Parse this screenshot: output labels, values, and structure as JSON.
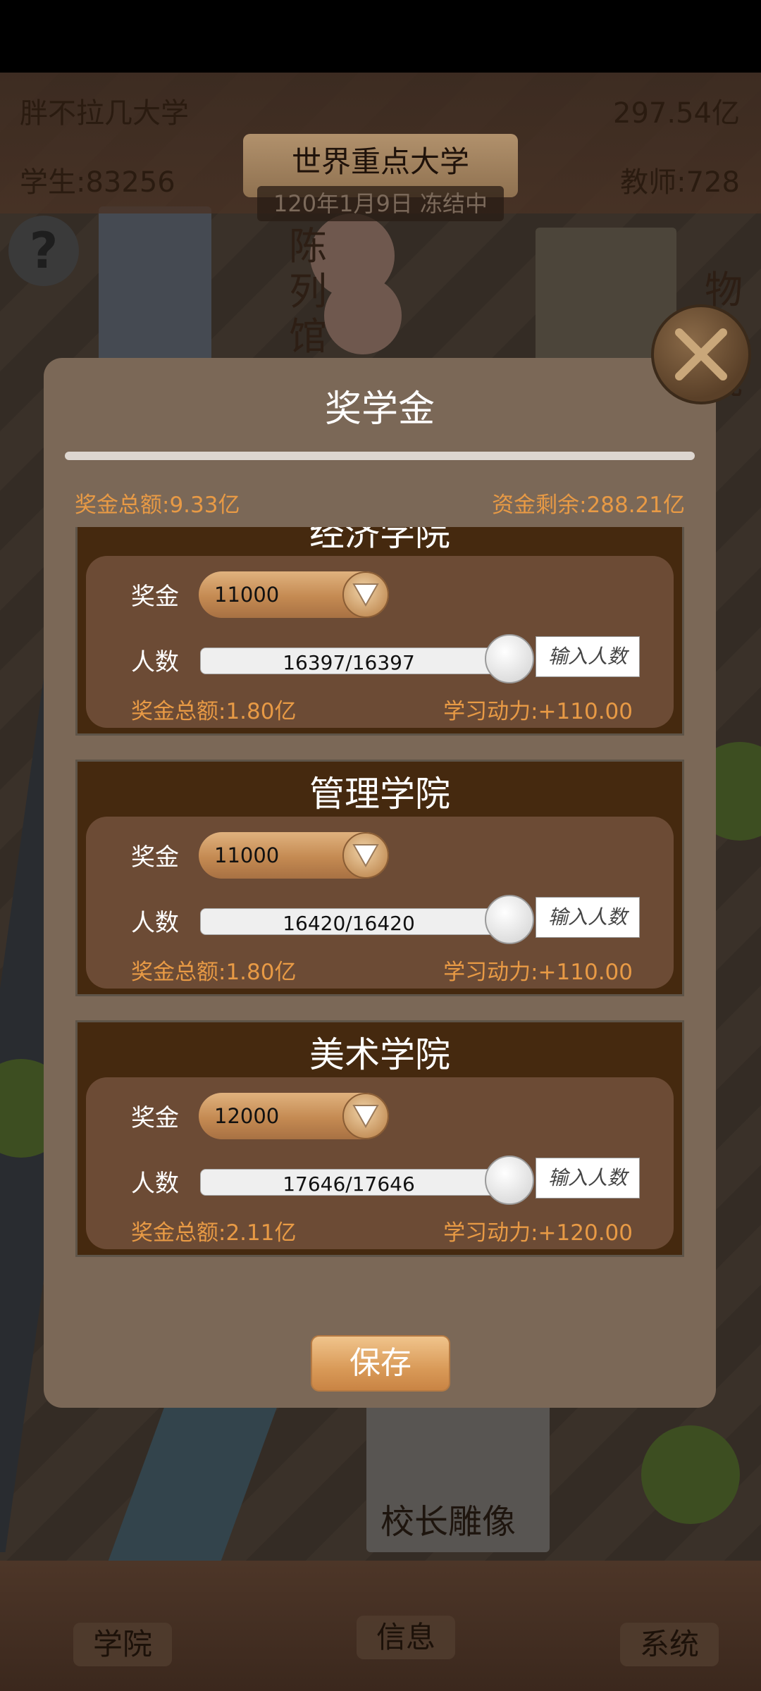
{
  "header": {
    "university_name": "胖不拉几大学",
    "money": "297.54亿",
    "students": "学生:83256",
    "teachers": "教师:728",
    "banner_title": "世界重点大学",
    "date_status": "120年1月9日 冻结中",
    "help_icon": "?"
  },
  "scene_labels": {
    "exhibition_hall": "陈\n列\n馆",
    "physics_partial": "物\n\n院",
    "statue": "校长雕像"
  },
  "bottom_nav": {
    "college": "学院",
    "info": "信息",
    "system": "系统"
  },
  "modal": {
    "title": "奖学金",
    "total_award": "奖金总额:9.33亿",
    "remaining_funds": "资金剩余:288.21亿",
    "save_label": "保存",
    "award_label": "奖金",
    "count_label": "人数",
    "count_input_placeholder": "输入人数",
    "colleges": [
      {
        "name": "经济学院",
        "award": "11000",
        "count": "16397/16397",
        "total": "奖金总额:1.80亿",
        "motivation": "学习动力:+110.00"
      },
      {
        "name": "管理学院",
        "award": "11000",
        "count": "16420/16420",
        "total": "奖金总额:1.80亿",
        "motivation": "学习动力:+110.00"
      },
      {
        "name": "美术学院",
        "award": "12000",
        "count": "17646/17646",
        "total": "奖金总额:2.11亿",
        "motivation": "学习动力:+120.00"
      }
    ]
  },
  "icons": {
    "close": "close-icon",
    "dropdown": "chevron-down-icon",
    "help": "question-icon"
  },
  "colors": {
    "accent_orange": "#e89a45",
    "modal_bg": "#7b6857",
    "college_header": "#45290f",
    "college_inner": "#6c4b35"
  }
}
